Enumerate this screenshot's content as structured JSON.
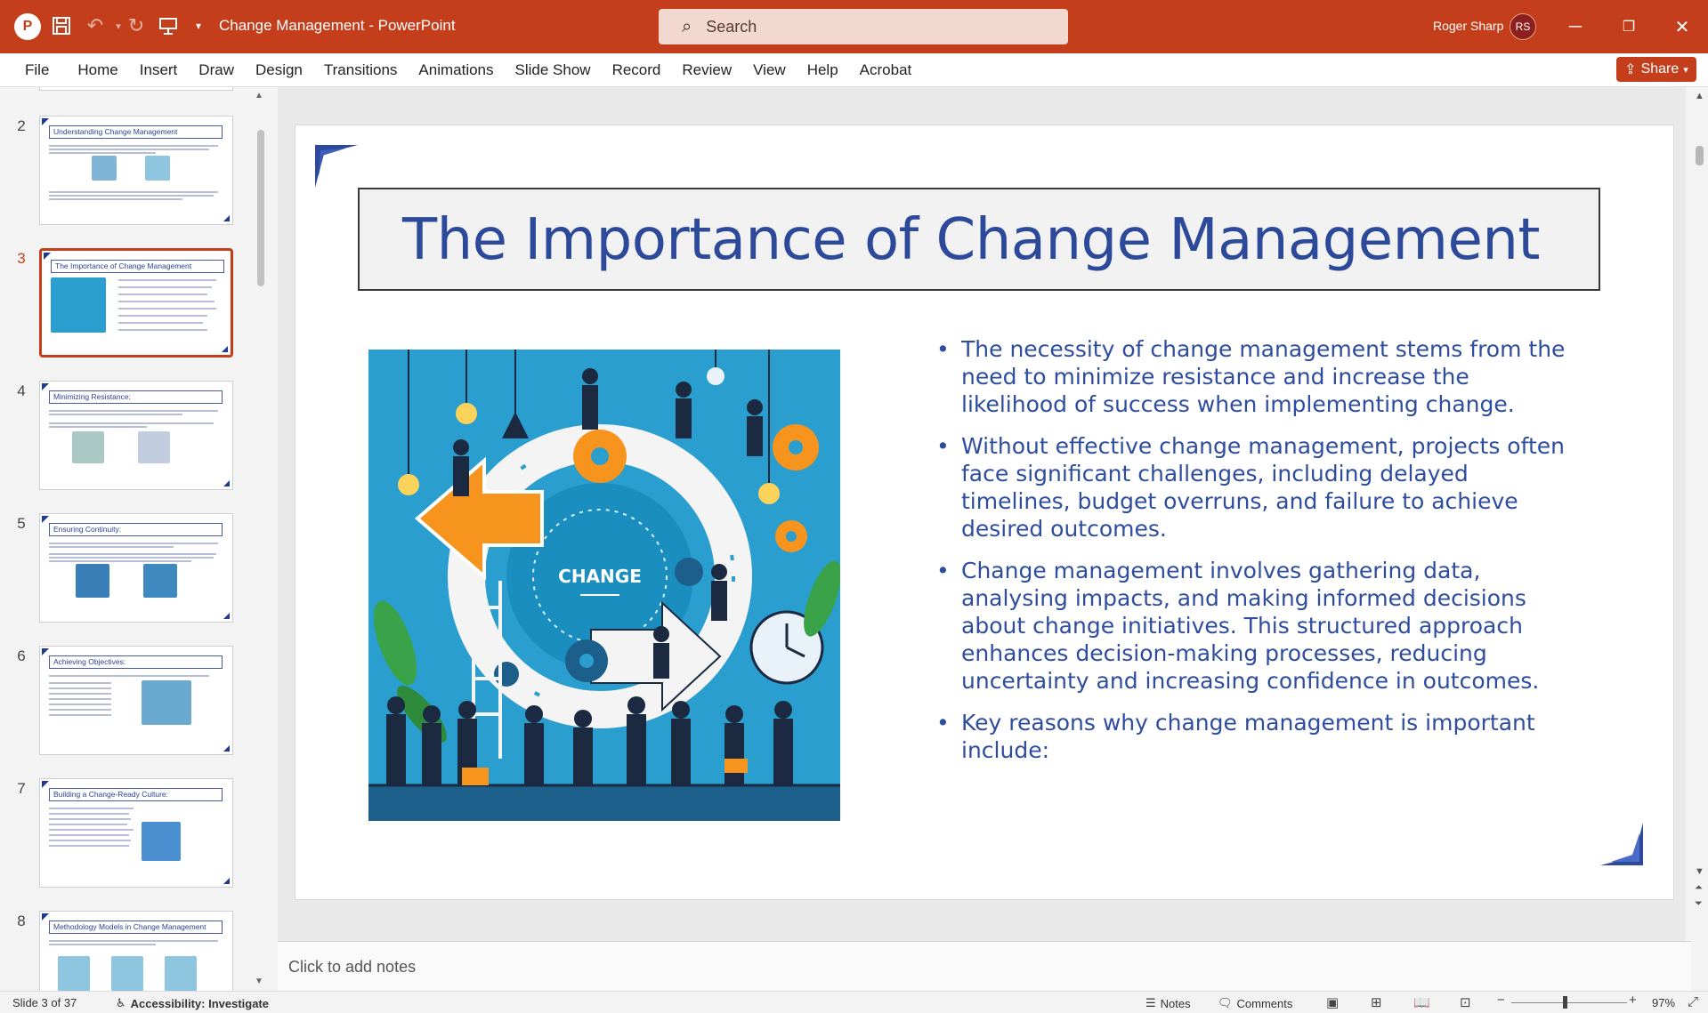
{
  "titlebar": {
    "doc_title": "Change Management  -  PowerPoint",
    "search_placeholder": "Search",
    "user_name": "Roger Sharp",
    "user_initials": "RS"
  },
  "ribbon": {
    "tabs": [
      "File",
      "Home",
      "Insert",
      "Draw",
      "Design",
      "Transitions",
      "Animations",
      "Slide Show",
      "Record",
      "Review",
      "View",
      "Help",
      "Acrobat"
    ],
    "share_label": "Share"
  },
  "thumbnails": [
    {
      "num": "2",
      "title": "Understanding Change Management",
      "active": false
    },
    {
      "num": "3",
      "title": "The Importance of Change Management",
      "active": true
    },
    {
      "num": "4",
      "title": "Minimizing Resistance:",
      "active": false
    },
    {
      "num": "5",
      "title": "Ensuring Continuity:",
      "active": false
    },
    {
      "num": "6",
      "title": "Achieving Objectives:",
      "active": false
    },
    {
      "num": "7",
      "title": "Building a Change-Ready Culture:",
      "active": false
    },
    {
      "num": "8",
      "title": "Methodology Models in Change Management",
      "active": false
    }
  ],
  "slide": {
    "title": "The Importance of Change Management",
    "image_label": "CHANGE",
    "bullets": [
      "The necessity of change management stems from the need to minimize resistance and increase the likelihood of success when implementing change.",
      "Without effective change management, projects often face significant challenges, including delayed timelines, budget overruns, and failure to achieve desired outcomes.",
      "Change management involves gathering data, analysing impacts, and making informed decisions about change initiatives. This structured approach enhances decision-making processes, reducing uncertainty and increasing confidence in outcomes.",
      "Key reasons why change management is important include:"
    ]
  },
  "notes_placeholder": "Click to add notes",
  "statusbar": {
    "slide_info": "Slide 3 of 37",
    "accessibility": "Accessibility: Investigate",
    "notes_label": "Notes",
    "comments_label": "Comments",
    "zoom": "97%"
  },
  "colors": {
    "accent": "#c43e1c",
    "title_blue": "#2d4a9a",
    "image_bg": "#2a9fcf",
    "orange": "#f7941d"
  }
}
